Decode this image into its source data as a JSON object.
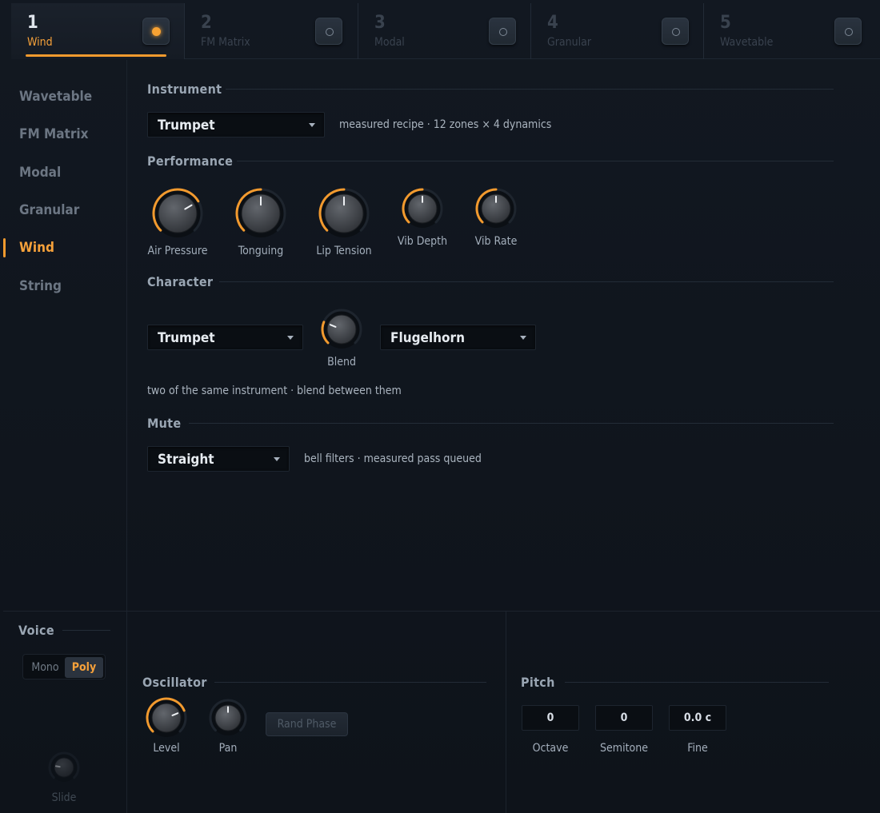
{
  "slots": [
    {
      "num": "1",
      "name": "Wind",
      "active": true
    },
    {
      "num": "2",
      "name": "FM Matrix",
      "active": false
    },
    {
      "num": "3",
      "name": "Modal",
      "active": false
    },
    {
      "num": "4",
      "name": "Granular",
      "active": false
    },
    {
      "num": "5",
      "name": "Wavetable",
      "active": false
    }
  ],
  "nav": {
    "items": [
      {
        "label": "Wavetable"
      },
      {
        "label": "FM Matrix"
      },
      {
        "label": "Modal"
      },
      {
        "label": "Granular"
      },
      {
        "label": "Wind"
      },
      {
        "label": "String"
      }
    ],
    "active": "Wind"
  },
  "instrument": {
    "title": "Instrument",
    "selected": "Trumpet",
    "note": "measured recipe · 12 zones × 4 dynamics"
  },
  "performance": {
    "title": "Performance",
    "knobs": [
      {
        "label": "Air Pressure",
        "value": 0.72
      },
      {
        "label": "Tonguing",
        "value": 0.5
      },
      {
        "label": "Lip Tension",
        "value": 0.5
      },
      {
        "label": "Vib Depth",
        "value": 0.5
      },
      {
        "label": "Vib Rate",
        "value": 0.5
      }
    ]
  },
  "character": {
    "title": "Character",
    "left": "Trumpet",
    "right": "Flugelhorn",
    "blend": {
      "label": "Blend",
      "value": 0.25
    },
    "note": "two of the same instrument · blend between them"
  },
  "mute": {
    "title": "Mute",
    "selected": "Straight",
    "note": "bell filters · measured pass queued"
  },
  "voice": {
    "title": "Voice",
    "modes": [
      "Mono",
      "Poly"
    ],
    "selected": "Poly",
    "slide_label": "Slide",
    "slide_value": 0.2
  },
  "oscillator": {
    "title": "Oscillator",
    "level": {
      "label": "Level",
      "value": 0.75
    },
    "pan": {
      "label": "Pan",
      "value": 0.5
    },
    "rand_phase_label": "Rand Phase"
  },
  "pitch": {
    "title": "Pitch",
    "octave": {
      "label": "Octave",
      "value": "0"
    },
    "semitone": {
      "label": "Semitone",
      "value": "0"
    },
    "fine": {
      "label": "Fine",
      "value": "0.0 c"
    }
  },
  "colors": {
    "accent": "#f29a2e",
    "background": "#0f141b",
    "knob_body": "#4a4e54"
  }
}
